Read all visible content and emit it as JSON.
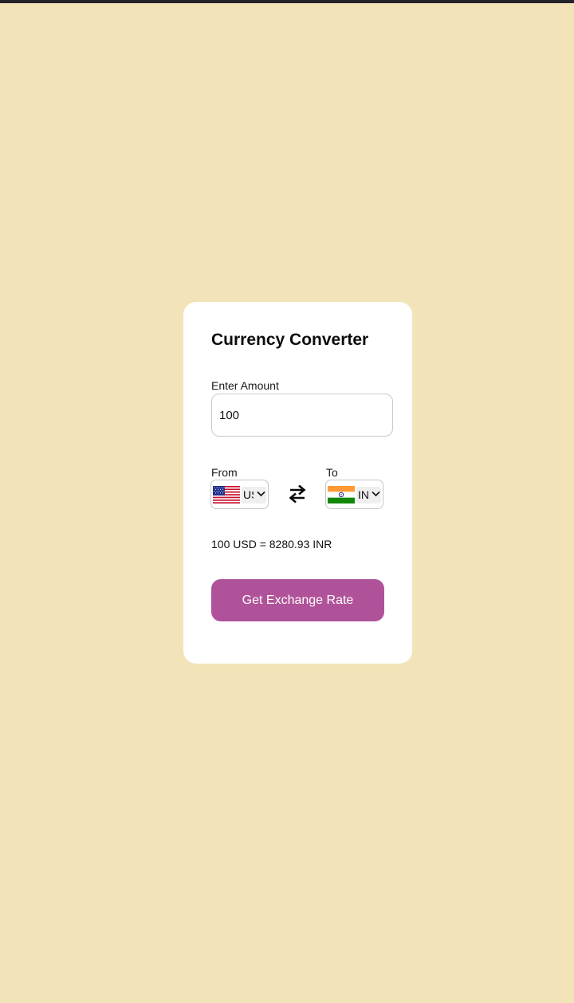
{
  "app": {
    "title": "Currency Converter",
    "background_color": "#f2e3b8",
    "accent_color": "#b05299"
  },
  "amount": {
    "label": "Enter Amount",
    "value": "100"
  },
  "from": {
    "label": "From",
    "currency_code": "USD",
    "flag_icon": "us-flag-icon"
  },
  "to": {
    "label": "To",
    "currency_code": "INR",
    "flag_icon": "india-flag-icon"
  },
  "swap_icon": "swap-arrows-icon",
  "result_text": "100 USD = 8280.93 INR",
  "button": {
    "label": "Get Exchange Rate"
  }
}
